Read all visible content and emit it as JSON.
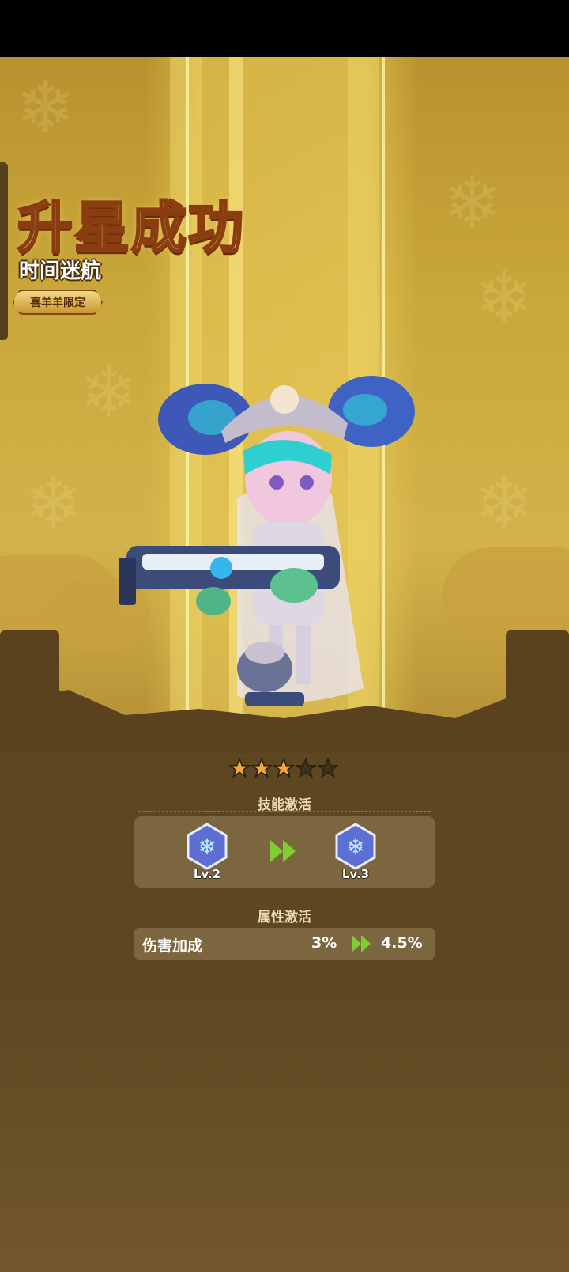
{
  "title": "升星成功",
  "character_name": "时间迷航",
  "limited_badge": "喜羊羊限定",
  "stars": {
    "total": 5,
    "filled": 3
  },
  "skill_section": {
    "title": "技能激活",
    "from_level": "Lv.2",
    "to_level": "Lv.3",
    "icon": "snowflake-skill-icon"
  },
  "attribute_section": {
    "title": "属性激活",
    "name": "伤害加成",
    "old_value": "3%",
    "new_value": "4.5%"
  },
  "colors": {
    "background_top": "#c9a73a",
    "background_bottom": "#5e4621",
    "panel": "#7c6640",
    "star_filled": "#f2a93b",
    "arrow": "#7ccf2f",
    "skill_gem": "#6b7fe0"
  }
}
